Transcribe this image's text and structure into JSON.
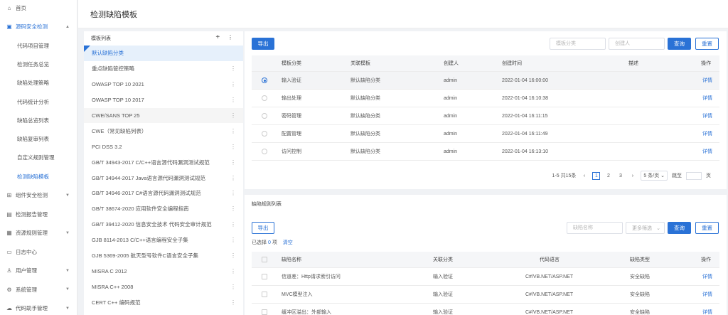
{
  "sidebar": {
    "items": [
      {
        "label": "首页",
        "icon": "home-icon",
        "glyph": "⌂"
      },
      {
        "label": "源码安全检测",
        "icon": "code-scan-icon",
        "glyph": "▣",
        "expanded": true
      },
      {
        "label": "组件安全检测",
        "icon": "component-icon",
        "glyph": "⊞"
      },
      {
        "label": "检测报告管理",
        "icon": "report-icon",
        "glyph": "▤"
      },
      {
        "label": "资源规则管理",
        "icon": "rules-icon",
        "glyph": "▦"
      },
      {
        "label": "日志中心",
        "icon": "log-icon",
        "glyph": "▭"
      },
      {
        "label": "用户管理",
        "icon": "user-icon",
        "glyph": "♙"
      },
      {
        "label": "系统管理",
        "icon": "settings-icon",
        "glyph": "⚙"
      },
      {
        "label": "代码助手管理",
        "icon": "assistant-icon",
        "glyph": "☁"
      }
    ],
    "sub_items": [
      "代码项目管理",
      "检测任务总览",
      "缺陷处理策略",
      "代码统计分析",
      "缺陷总览列表",
      "缺陷复审列表",
      "自定义规则管理",
      "检测缺陷模板"
    ]
  },
  "header": {
    "title": "检测缺陷模板"
  },
  "template_list": {
    "title": "模板列表",
    "add": "+",
    "more": "⋮",
    "items": [
      "默认缺陷分类",
      "重点缺陷管控策略",
      "OWASP TOP 10 2021",
      "OWASP TOP 10 2017",
      "CWE/SANS TOP 25",
      "CWE（常见缺陷列表）",
      "PCI DSS 3.2",
      "GB/T 34943-2017 C/C++语言源代码漏洞测试规范",
      "GB/T 34944-2017 Java语言源代码漏洞测试规范",
      "GB/T 34946-2017 C#语言源代码漏洞测试规范",
      "GB/T 38674-2020 应用软件安全编程指南",
      "GB/T 39412-2020 信息安全技术 代码安全审计规范",
      "GJB 8114-2013 C/C++语言编程安全子集",
      "GJB 5369-2005 航天型号软件C语言安全子集",
      "MISRA C 2012",
      "MISRA C++ 2008",
      "CERT C++ 编码规范"
    ]
  },
  "category_panel": {
    "export": "导出",
    "search_placeholder_1": "模板分类",
    "search_placeholder_2": "创建人",
    "query": "查询",
    "reset": "重置",
    "columns": [
      "模板分类",
      "关联模板",
      "创建人",
      "创建时间",
      "描述",
      "操作"
    ],
    "rows": [
      {
        "category": "输入验证",
        "template": "默认缺陷分类",
        "creator": "admin",
        "time": "2022-01-04 16:00:00",
        "action": "详情"
      },
      {
        "category": "输出处理",
        "template": "默认缺陷分类",
        "creator": "admin",
        "time": "2022-01-04 16:10:38",
        "action": "详情"
      },
      {
        "category": "密码管理",
        "template": "默认缺陷分类",
        "creator": "admin",
        "time": "2022-01-04 16:11:15",
        "action": "详情"
      },
      {
        "category": "配置管理",
        "template": "默认缺陷分类",
        "creator": "admin",
        "time": "2022-01-04 16:11:49",
        "action": "详情"
      },
      {
        "category": "访问控制",
        "template": "默认缺陷分类",
        "creator": "admin",
        "time": "2022-01-04 16:13:10",
        "action": "详情"
      }
    ],
    "pager": {
      "summary": "1-5 共15条",
      "prev": "‹",
      "pages": [
        "1",
        "2",
        "3"
      ],
      "next": "›",
      "size": "5 条/页 ⌄",
      "goto": "跳至",
      "page_unit": "页"
    }
  },
  "rules_panel": {
    "title": "缺陷规则列表",
    "export": "导出",
    "search_placeholder": "缺陷名称",
    "filter": "更多筛选",
    "filter_arrow": "⌄",
    "query": "查询",
    "reset": "重置",
    "selected_prefix": "已选择",
    "selected_count": "0",
    "selected_suffix": "项",
    "clear": "清空",
    "columns": [
      "缺陷名称",
      "关联分类",
      "代码语言",
      "缺陷类型",
      "操作"
    ],
    "rows": [
      {
        "name": "信道差：Http请求索引访问",
        "category": "输入验证",
        "lang": "C#/VB.NET/ASP.NET",
        "type": "安全缺陷",
        "action": "详情"
      },
      {
        "name": "MVC模型注入",
        "category": "输入验证",
        "lang": "C#/VB.NET/ASP.NET",
        "type": "安全缺陷",
        "action": "详情"
      },
      {
        "name": "缓冲区溢出：外部输入",
        "category": "输入验证",
        "lang": "C#/VB.NET/ASP.NET",
        "type": "安全缺陷",
        "action": "详情"
      }
    ]
  },
  "colors": {
    "accent": "#2a72d6"
  }
}
